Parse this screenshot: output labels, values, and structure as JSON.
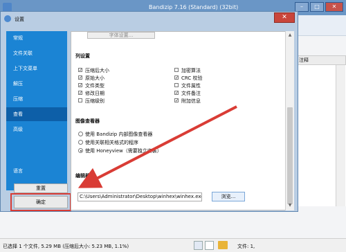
{
  "main": {
    "title": "Bandizip 7.16 (Standard) (32bit)",
    "column_header": "注释",
    "status_text": "已选择 1 个文件, 5.29 MB (压缩后大小: 5.23 MB, 1.1%)",
    "file_count": "文件: 1,"
  },
  "dialog": {
    "title": "设置",
    "close_glyph": "✕",
    "sidebar": [
      {
        "label": "常规"
      },
      {
        "label": "文件关联"
      },
      {
        "label": "上下文菜单"
      },
      {
        "label": "解压"
      },
      {
        "label": "压缩"
      },
      {
        "label": "查看"
      },
      {
        "label": "高级"
      },
      {
        "label": "语言"
      }
    ],
    "active_item": "查看",
    "reset_label": "重置",
    "ok_label": "确定",
    "font_button": "字体设置...",
    "columns_section": "列设置",
    "columns_left": [
      {
        "label": "压缩后大小",
        "checked": true
      },
      {
        "label": "原始大小",
        "checked": true
      },
      {
        "label": "文件类型",
        "checked": true
      },
      {
        "label": "修改日期",
        "checked": true
      },
      {
        "label": "压缩级别",
        "checked": false
      }
    ],
    "columns_right": [
      {
        "label": "加密算法",
        "checked": false
      },
      {
        "label": "CRC 校验",
        "checked": true
      },
      {
        "label": "文件属性",
        "checked": false
      },
      {
        "label": "文件备注",
        "checked": true
      },
      {
        "label": "附加信息",
        "checked": true
      }
    ],
    "viewer_section": "图像查看器",
    "viewer_options": [
      {
        "label": "使用 Bandizip 内部图像查看器",
        "selected": false
      },
      {
        "label": "使用关联相关格式的程序",
        "selected": false
      },
      {
        "label": "使用 Honeyview（需要独立安装）",
        "selected": true
      }
    ],
    "editor_section": "编辑器",
    "editor_path": "C:\\Users\\Administrator\\Desktop\\winhex\\winhex.exe",
    "browse_label": "浏览..."
  },
  "colors": {
    "accent": "#1b84d4",
    "active": "#0d5fa8",
    "highlight": "#d93c35"
  }
}
